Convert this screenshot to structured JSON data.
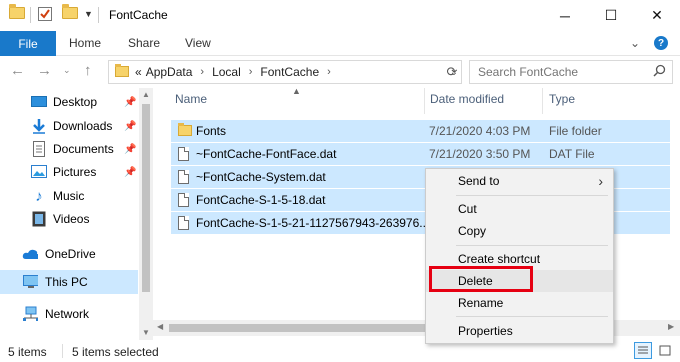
{
  "window": {
    "title": "FontCache",
    "minimize": "─",
    "maximize": "☐",
    "close": "✕"
  },
  "ribbon": {
    "file": "File",
    "tabs": [
      "Home",
      "Share",
      "View"
    ],
    "expand": "⌄",
    "help": "?"
  },
  "address": {
    "overflow": "«",
    "crumbs": [
      "AppData",
      "Local",
      "FontCache"
    ],
    "search_placeholder": "Search FontCache"
  },
  "nav": {
    "items": [
      {
        "label": "Desktop",
        "pinned": true
      },
      {
        "label": "Downloads",
        "pinned": true
      },
      {
        "label": "Documents",
        "pinned": true
      },
      {
        "label": "Pictures",
        "pinned": true
      },
      {
        "label": "Music",
        "pinned": false
      },
      {
        "label": "Videos",
        "pinned": false
      },
      {
        "label": "OneDrive",
        "pinned": false
      },
      {
        "label": "This PC",
        "pinned": false,
        "selected": true
      },
      {
        "label": "Network",
        "pinned": false
      }
    ]
  },
  "columns": {
    "name": "Name",
    "date": "Date modified",
    "type": "Type"
  },
  "files": [
    {
      "name": "Fonts",
      "date": "7/21/2020 4:03 PM",
      "type": "File folder",
      "kind": "folder"
    },
    {
      "name": "~FontCache-FontFace.dat",
      "date": "7/21/2020 3:50 PM",
      "type": "DAT File",
      "kind": "file"
    },
    {
      "name": "~FontCache-System.dat",
      "date": "",
      "type": "",
      "kind": "file"
    },
    {
      "name": "FontCache-S-1-5-18.dat",
      "date": "",
      "type": "",
      "kind": "file"
    },
    {
      "name": "FontCache-S-1-5-21-1127567943-263976...",
      "date": "",
      "type": "",
      "kind": "file"
    }
  ],
  "context_menu": {
    "send_to": "Send to",
    "cut": "Cut",
    "copy": "Copy",
    "create_shortcut": "Create shortcut",
    "delete": "Delete",
    "rename": "Rename",
    "properties": "Properties"
  },
  "status": {
    "count": "5 items",
    "selected": "5 items selected"
  },
  "colors": {
    "accent": "#1979ca",
    "selection": "#cce8ff",
    "highlight_box": "#e60012"
  }
}
